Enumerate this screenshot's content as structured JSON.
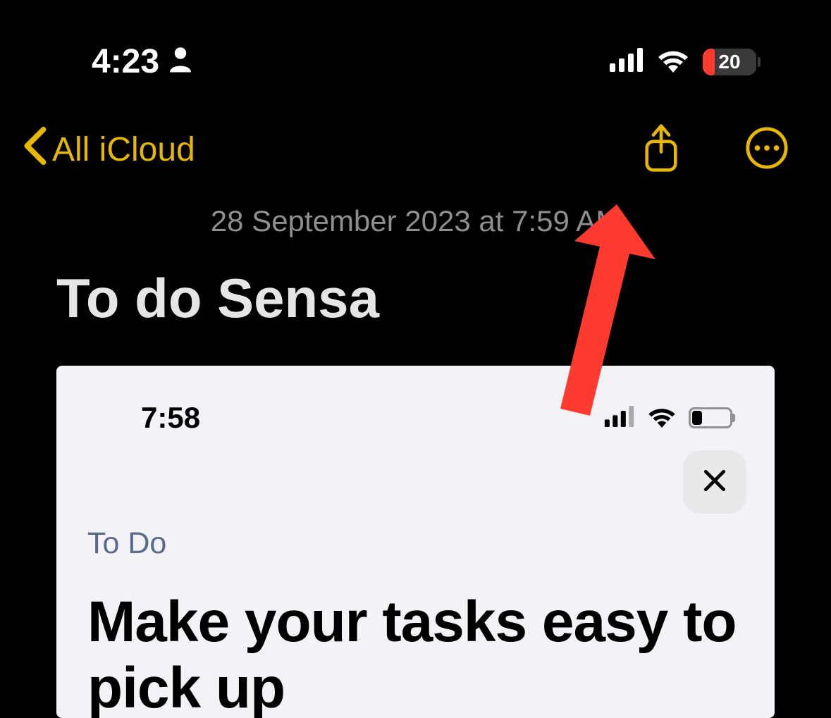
{
  "outer_status": {
    "time": "4:23",
    "battery_percent": "20"
  },
  "nav": {
    "back_label": "All iCloud"
  },
  "note": {
    "timestamp": "28 September 2023 at 7:59 AM",
    "title": "To do Sensa"
  },
  "embedded": {
    "status_time": "7:58",
    "category": "To Do",
    "heading": "Make your tasks easy to pick up"
  }
}
